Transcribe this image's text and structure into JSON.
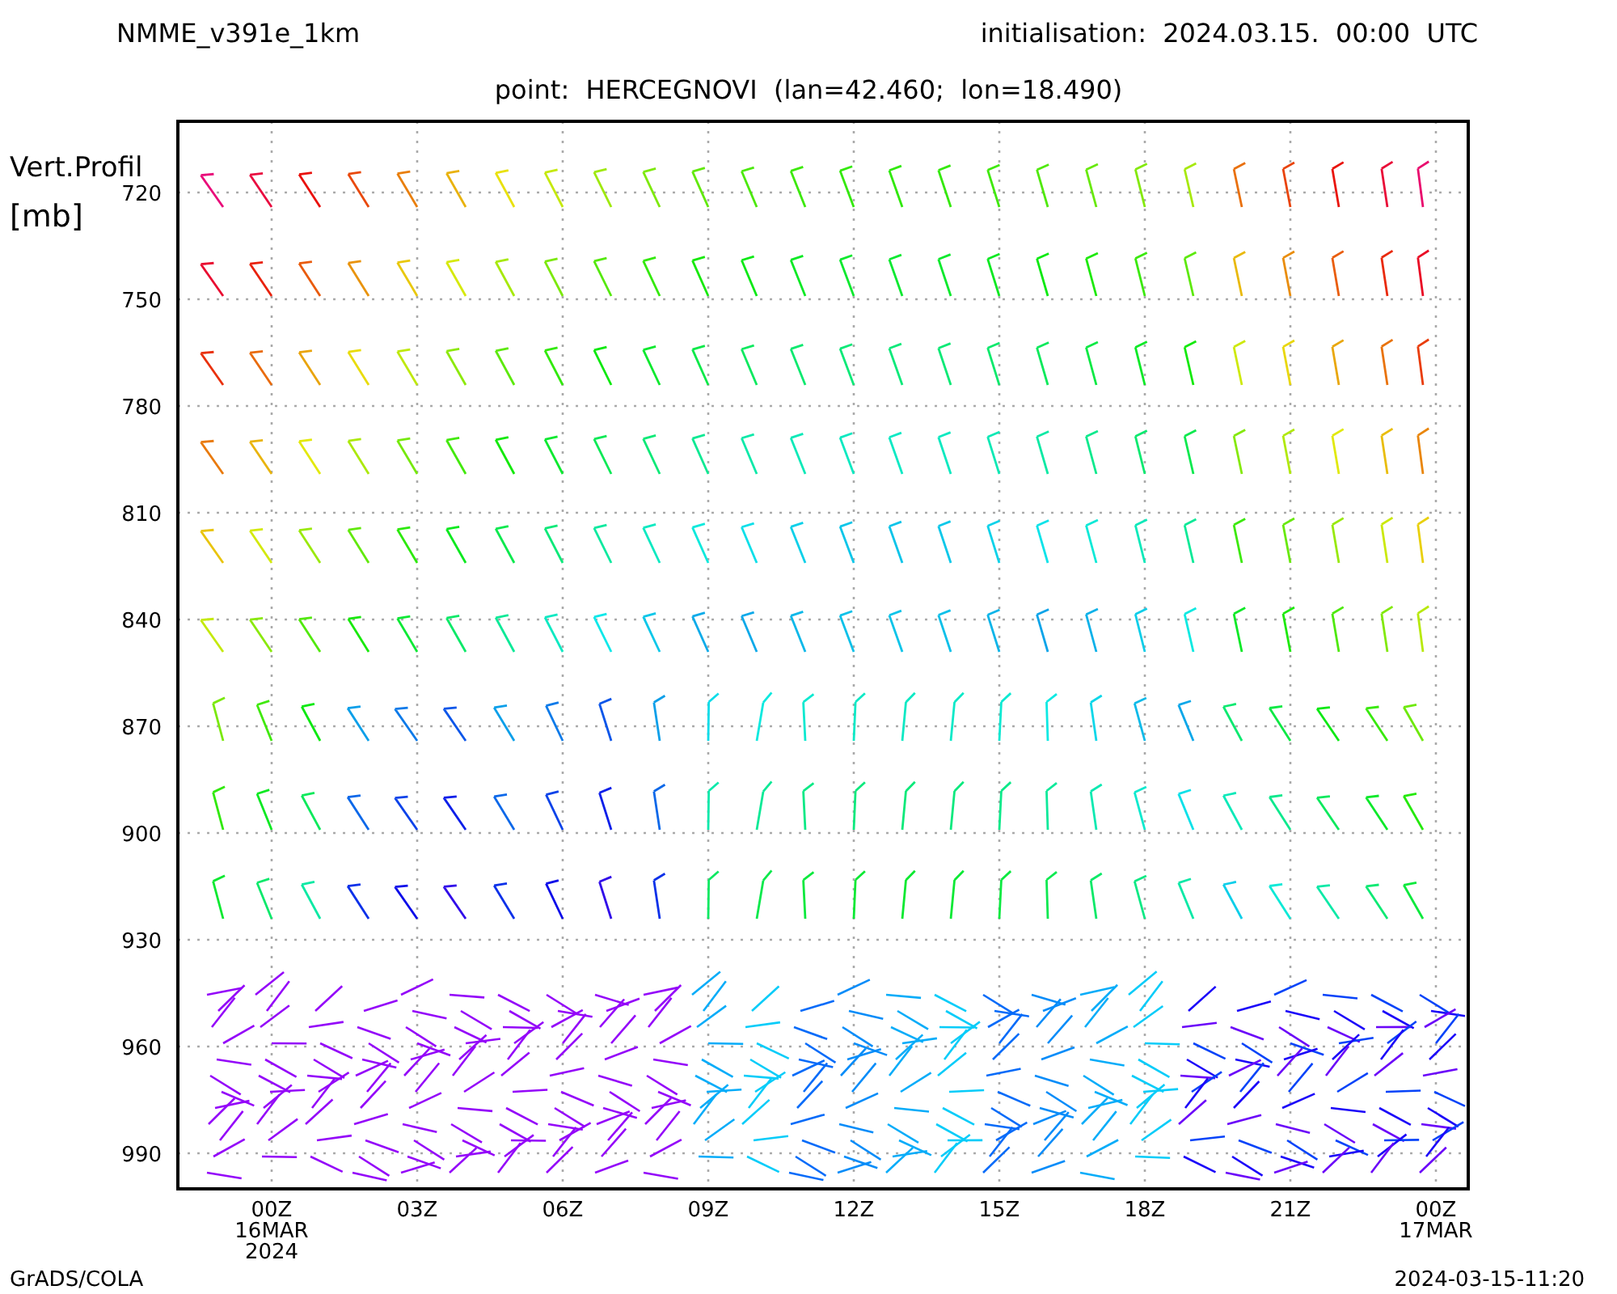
{
  "header": {
    "model": "NMME_v391e_1km",
    "initialisation": "initialisation:  2024.03.15.  00:00  UTC"
  },
  "subtitle": "point:  HERCEGNOVI  (lan=42.460;  lon=18.490)",
  "y_axis": {
    "title": "Vert.Profil",
    "unit": "[mb]",
    "ticks": [
      "720",
      "750",
      "780",
      "810",
      "840",
      "870",
      "900",
      "930",
      "960",
      "990"
    ]
  },
  "x_axis": {
    "ticks": [
      {
        "time": "00Z",
        "date": "16MAR",
        "year": "2024"
      },
      {
        "time": "03Z"
      },
      {
        "time": "06Z"
      },
      {
        "time": "09Z"
      },
      {
        "time": "12Z"
      },
      {
        "time": "15Z"
      },
      {
        "time": "18Z"
      },
      {
        "time": "21Z"
      },
      {
        "time": "00Z",
        "date": "17MAR"
      }
    ]
  },
  "footer": {
    "credit": "GrADS/COLA",
    "timestamp": "2024-03-15-11:20"
  }
}
